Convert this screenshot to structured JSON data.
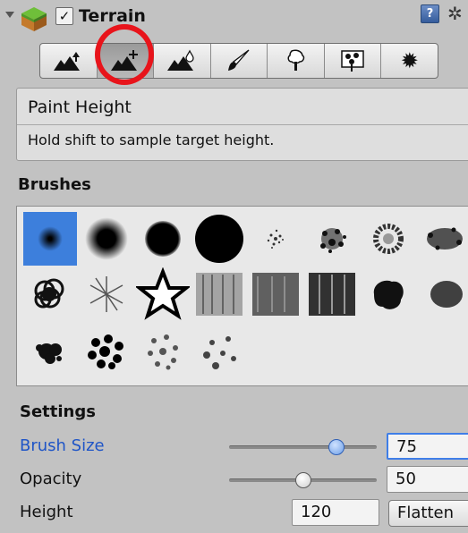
{
  "header": {
    "title": "Terrain",
    "enabled": true,
    "help_glyph": "?",
    "icons": [
      "foldout-arrow-icon",
      "terrain-cube-icon",
      "help-icon",
      "gear-icon"
    ]
  },
  "toolbar": {
    "tools": [
      {
        "name": "raise-lower-terrain",
        "icon": "mountain-up-arrow-icon",
        "active": false
      },
      {
        "name": "paint-height",
        "icon": "mountain-plus-icon",
        "active": true
      },
      {
        "name": "smooth-height",
        "icon": "mountain-drop-icon",
        "active": false
      },
      {
        "name": "paint-texture",
        "icon": "paintbrush-icon",
        "active": false
      },
      {
        "name": "place-trees",
        "icon": "tree-icon",
        "active": false
      },
      {
        "name": "paint-details",
        "icon": "flowers-icon",
        "active": false
      },
      {
        "name": "terrain-settings",
        "icon": "gear-icon",
        "active": false
      }
    ],
    "highlight_color": "#e8141b"
  },
  "info": {
    "tool_name": "Paint Height",
    "hint": "Hold shift to sample target height."
  },
  "brushes": {
    "heading": "Brushes",
    "selected_index": 0,
    "count": 20,
    "selected_color": "#3d7fdc"
  },
  "settings": {
    "heading": "Settings",
    "brush_size": {
      "label": "Brush Size",
      "value": "75",
      "slider_fraction": 0.82
    },
    "opacity": {
      "label": "Opacity",
      "value": "50",
      "slider_fraction": 0.5
    },
    "height": {
      "label": "Height",
      "value": "120",
      "button": "Flatten"
    }
  }
}
